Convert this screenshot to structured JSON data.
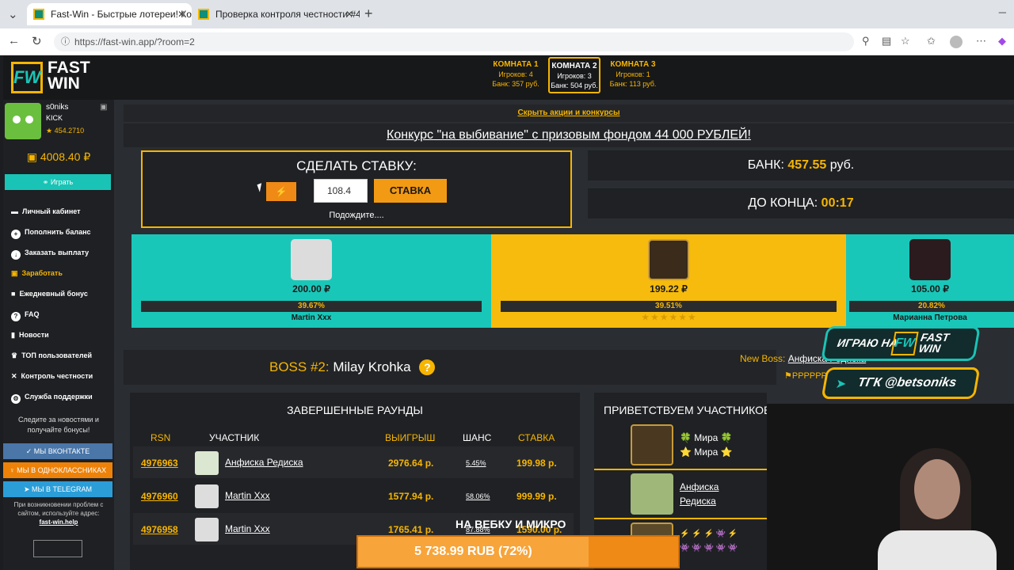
{
  "browser": {
    "tabs": [
      {
        "title": "Fast-Win - Быстрые лотереи! Ком"
      },
      {
        "title": "Проверка контроля честности #4"
      }
    ],
    "url": "https://fast-win.app/?room=2"
  },
  "logo": {
    "mark": "FW",
    "line1": "FAST",
    "line2": "WIN"
  },
  "rooms": [
    {
      "name": "КОМНАТА 1",
      "players": "Игроков: 4",
      "bank": "Банк: 357 руб."
    },
    {
      "name": "КОМНАТА 2",
      "players": "Игроков: 3",
      "bank": "Банк: 504 руб."
    },
    {
      "name": "КОМНАТА 3",
      "players": "Игроков: 1",
      "bank": "Банк: 113 руб."
    }
  ],
  "user": {
    "name": "s0niks",
    "status": "KICK",
    "rating": "★ 454.2710",
    "balance": "4008.40 ₽"
  },
  "sidebar": {
    "play": "Играть",
    "menu": [
      "Личный кабинет",
      "Пополнить баланс",
      "Заказать выплату",
      "Заработать",
      "Ежедневный бонус",
      "FAQ",
      "Новости",
      "ТОП пользователей",
      "Контроль честности",
      "Служба поддержки"
    ],
    "follow": "Следите за новостями и получайте бонусы!",
    "vk": "МЫ ВКОНТАКТЕ",
    "ok": "МЫ В ОДНОКЛАССНИКАХ",
    "tg": "МЫ В TELEGRAM",
    "problem": "При возникновении проблем с сайтом, используйте адрес:",
    "mirror": "fast-win.help"
  },
  "promo": {
    "hide": "Скрыть акции и конкурсы",
    "contest": "Конкурс \"на выбивание\" с призовым фондом 44 000 РУБЛЕЙ!"
  },
  "bet": {
    "title": "СДЕЛАТЬ СТАВКУ:",
    "value": "108.4",
    "button": "СТАВКА",
    "wait": "Подождите...."
  },
  "bank": {
    "label": "БАНК:",
    "value": "457.55",
    "unit": "руб."
  },
  "timer": {
    "label": "ДО КОНЦА:",
    "value": "00:17"
  },
  "players": [
    {
      "amount": "200.00 ₽",
      "chance": "39.67%",
      "name": "Martin Xxx",
      "color": "#19c7b9"
    },
    {
      "amount": "199.22 ₽",
      "chance": "39.51%",
      "name": "★ ★ ★ ★ ★ ★",
      "color": "#f6bb0c"
    },
    {
      "amount": "105.00 ₽",
      "chance": "20.82%",
      "name": "Марианна Петрова",
      "color": "#19c7b9"
    }
  ],
  "boss": {
    "label": "BOSS #2:",
    "name": "Milay Krohka",
    "q": "?",
    "new_label": "New Boss:",
    "new_name": "Анфиска Редиска",
    "extra": "РРРРРР"
  },
  "rounds": {
    "title": "ЗАВЕРШЕННЫЕ РАУНДЫ",
    "headers": [
      "RSN",
      "УЧАСТНИК",
      "ВЫИГРЫШ",
      "ШАНС",
      "СТАВКА"
    ],
    "rows": [
      {
        "id": "4976963",
        "name": "Анфиска Редиска",
        "win": "2976.64 р.",
        "chance": "5.45%",
        "stake": "199.98 р."
      },
      {
        "id": "4976960",
        "name": "Martin Xxx",
        "win": "1577.94 р.",
        "chance": "58.06%",
        "stake": "999.99 р."
      },
      {
        "id": "4976958",
        "name": "Martin Xxx",
        "win": "1765.41 р.",
        "chance": "87.88%",
        "stake": "1590.00 р."
      }
    ]
  },
  "welcome": {
    "title": "ПРИВЕТСТВУЕМ УЧАСТНИКОВ",
    "entries": [
      {
        "line1": "🍀 Мира 🍀",
        "line2": "⭐ Мира ⭐"
      },
      {
        "line1": "Анфиска",
        "line2": "Редиска"
      },
      {
        "line1": "⚡ ⚡ ⚡ 👾 ⚡",
        "line2": "👾 👾 👾 👾 👾"
      }
    ]
  },
  "stream": {
    "play_label": "ИГРАЮ НА",
    "fast_win_mark": "FW",
    "fast_win_text1": "FAST",
    "fast_win_text2": "WIN",
    "tg_label": "ТГК @betsoniks",
    "cam_label": "НА ВЕБКУ И МИКРО",
    "donation": "5 738.99 RUB (72%)",
    "donation_progress": 0.72
  }
}
